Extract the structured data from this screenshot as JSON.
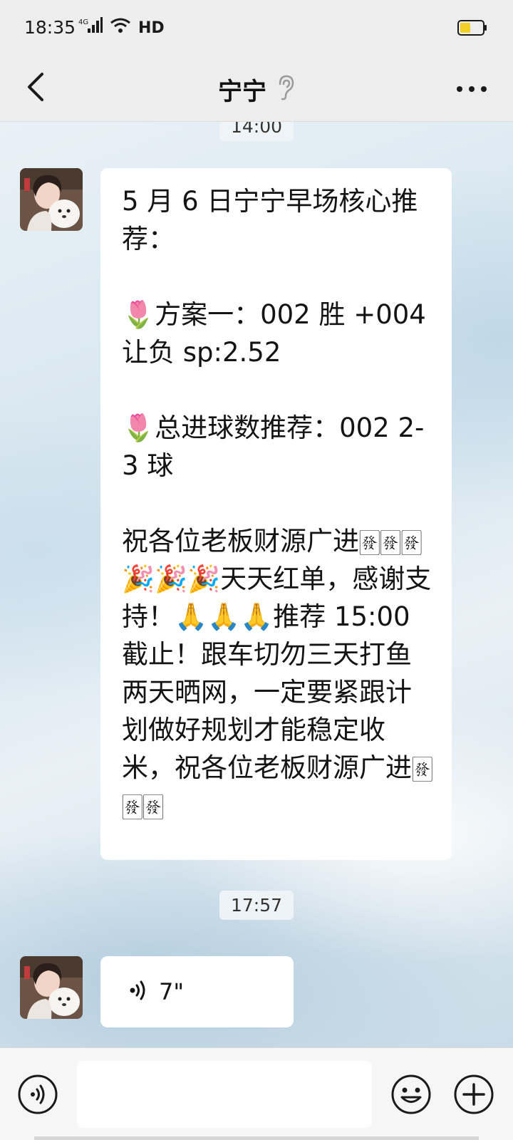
{
  "status_bar": {
    "time": "18:35",
    "network": "4G",
    "hd": "HD",
    "battery_level": 0.45,
    "battery_color": "#f2d028"
  },
  "header": {
    "title": "宁宁",
    "back_icon": "chevron-left-icon",
    "earpiece_icon": "ear-icon",
    "more_icon": "more-dots-icon"
  },
  "chat": {
    "top_time": "14:00",
    "messages": [
      {
        "sender": "宁宁",
        "type": "text",
        "text": "5 月 6 日宁宁早场核心推荐：\n\n🌷方案一：002 胜 +004 让负 sp:2.52\n\n🌷总进球数推荐：002 2-3 球\n\n祝各位老板财源广进🀅🀅🀅🎉🎉🎉天天红单，感谢支持！🙏🙏🙏推荐 15:00 截止！跟车切勿三天打鱼两天晒网，一定要紧跟计划做好规划才能稳定收米，祝各位老板财源广进🀅🀅🀅"
      },
      {
        "sender": "宁宁",
        "type": "voice",
        "time_before": "17:57",
        "duration": "7\""
      }
    ]
  },
  "input_bar": {
    "voice_icon": "voice-mode-icon",
    "placeholder": "",
    "emoji_icon": "emoji-smile-icon",
    "plus_icon": "plus-circle-icon"
  },
  "colors": {
    "bar_bg": "#ededed",
    "bubble_bg": "#ffffff",
    "text": "#141414"
  }
}
